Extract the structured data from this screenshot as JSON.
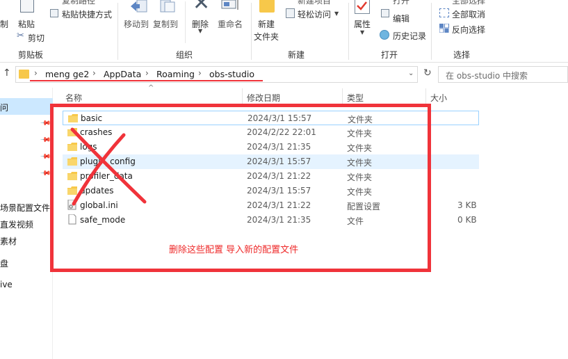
{
  "ribbon": {
    "clipboard": {
      "cut_partial": "制",
      "paste": "粘贴",
      "copy_path_partial": "复制路径",
      "paste_shortcut": "粘贴快捷方式",
      "cut": "剪切",
      "group": "剪贴板"
    },
    "organize": {
      "move_to": "移动到",
      "copy_to": "复制到",
      "delete": "删除",
      "rename": "重命名",
      "group": "组织"
    },
    "new": {
      "new_item_partial": "新建项目",
      "easy_access": "轻松访问",
      "new_folder_line1": "新建",
      "new_folder_line2": "文件夹",
      "group": "新建"
    },
    "open": {
      "properties": "属性",
      "open_partial": "打开",
      "edit": "编辑",
      "history": "历史记录",
      "group": "打开"
    },
    "select": {
      "select_all_partial": "全部选择",
      "select_none": "全部取消",
      "invert": "反向选择",
      "group": "选择"
    }
  },
  "address": {
    "crumbs": [
      "meng ge2",
      "AppData",
      "Roaming",
      "obs-studio"
    ],
    "search_placeholder": "在 obs-studio 中搜索"
  },
  "nav": {
    "items": [
      "问",
      "场景配置文件",
      "直发视频",
      "素材",
      "盘",
      "ive"
    ]
  },
  "columns": {
    "name": "名称",
    "date": "修改日期",
    "type": "类型",
    "size": "大小"
  },
  "files": [
    {
      "name": "basic",
      "date": "2024/3/1 15:57",
      "type": "文件夹",
      "size": "",
      "icon": "folder"
    },
    {
      "name": "crashes",
      "date": "2024/2/22 22:01",
      "type": "文件夹",
      "size": "",
      "icon": "folder"
    },
    {
      "name": "logs",
      "date": "2024/3/1 21:35",
      "type": "文件夹",
      "size": "",
      "icon": "folder"
    },
    {
      "name": "plugin_config",
      "date": "2024/3/1 15:57",
      "type": "文件夹",
      "size": "",
      "icon": "folder"
    },
    {
      "name": "profiler_data",
      "date": "2024/3/1 21:22",
      "type": "文件夹",
      "size": "",
      "icon": "folder"
    },
    {
      "name": "updates",
      "date": "2024/3/1 15:57",
      "type": "文件夹",
      "size": "",
      "icon": "folder"
    },
    {
      "name": "global.ini",
      "date": "2024/3/1 21:22",
      "type": "配置设置",
      "size": "3 KB",
      "icon": "ini-file"
    },
    {
      "name": "safe_mode",
      "date": "2024/3/1 21:35",
      "type": "文件",
      "size": "0 KB",
      "icon": "blank-file"
    }
  ],
  "annotation": {
    "text": "删除这些配置 导入新的配置文件",
    "color": "#f0333a"
  },
  "colors": {
    "folder": "#f7c84a",
    "selection": "#e5f3ff",
    "annotation_red": "#f0333a"
  }
}
